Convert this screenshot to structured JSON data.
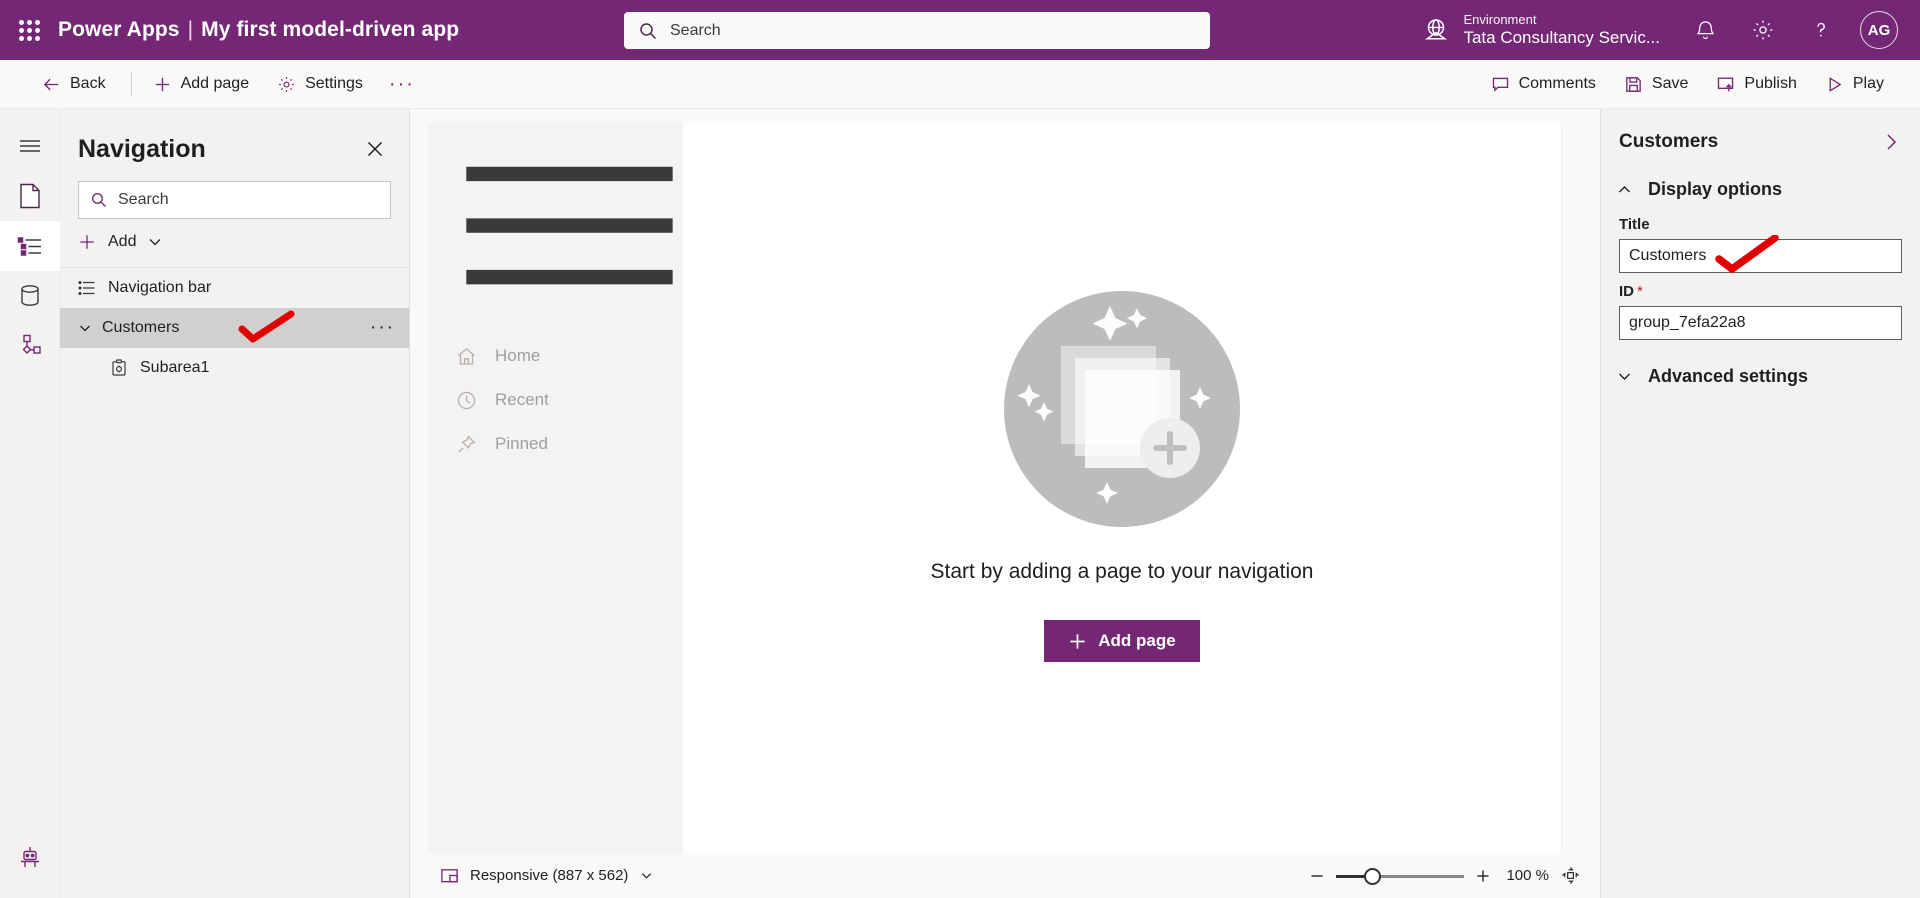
{
  "header": {
    "waffle_icon": "waffle-grid-icon",
    "brand": "Power Apps",
    "separator": "|",
    "app_name": "My first model-driven app",
    "search": {
      "placeholder": "Search",
      "value": "",
      "icon": "search-icon"
    },
    "environment": {
      "label": "Environment",
      "name": "Tata Consultancy Servic...",
      "icon": "globe-icon"
    },
    "notifications_icon": "bell-icon",
    "settings_icon": "gear-icon",
    "help_icon": "question-icon",
    "avatar_initials": "AG",
    "brand_color": "#742774"
  },
  "commandbar": {
    "back": "Back",
    "add_page": "Add page",
    "settings": "Settings",
    "overflow": "···",
    "comments": "Comments",
    "save": "Save",
    "publish": "Publish",
    "play": "Play"
  },
  "rail": {
    "items": [
      {
        "name": "pages-menu",
        "icon": "hamburger-icon",
        "selected": false
      },
      {
        "name": "pages",
        "icon": "page-icon",
        "selected": false
      },
      {
        "name": "navigation",
        "icon": "navigation-tree-icon",
        "selected": true
      },
      {
        "name": "data",
        "icon": "database-icon",
        "selected": false
      },
      {
        "name": "automation",
        "icon": "flow-nodes-icon",
        "selected": false
      }
    ],
    "bottom_icon": "copilot-robot-icon"
  },
  "navigation_panel": {
    "title": "Navigation",
    "close_icon": "close-icon",
    "search": {
      "placeholder": "Search",
      "value": "",
      "icon": "search-icon"
    },
    "add": {
      "label": "Add",
      "plus_icon": "plus-icon",
      "chevron_icon": "chevron-down-icon"
    },
    "tree": [
      {
        "label": "Navigation bar",
        "icon": "list-icon",
        "level": 0,
        "selected": false,
        "expandable": false
      },
      {
        "label": "Customers",
        "icon": "group-icon",
        "level": 0,
        "selected": true,
        "expandable": true,
        "more": "···"
      },
      {
        "label": "Subarea1",
        "icon": "subarea-icon",
        "level": 1,
        "selected": false,
        "expandable": false
      }
    ]
  },
  "preview": {
    "hamburger_icon": "hamburger-icon",
    "nav_items": [
      {
        "label": "Home",
        "icon": "home-icon"
      },
      {
        "label": "Recent",
        "icon": "clock-icon"
      },
      {
        "label": "Pinned",
        "icon": "pin-icon"
      }
    ],
    "empty_state": {
      "illustration": "stacked-pages-plus-illustration",
      "message": "Start by adding a page to your navigation",
      "button_label": "Add page",
      "button_icon": "plus-icon"
    }
  },
  "statusbar": {
    "responsive_label": "Responsive (887 x 562)",
    "responsive_icon": "device-frame-icon",
    "chevron_icon": "chevron-down-icon",
    "zoom_out_icon": "minus-icon",
    "zoom_in_icon": "plus-icon",
    "zoom_level": "100 %",
    "fit_icon": "fit-to-screen-icon"
  },
  "properties": {
    "title": "Customers",
    "expand_icon": "chevron-right-icon",
    "sections": [
      {
        "label": "Display options",
        "expanded": true,
        "icon": "chevron-up-icon"
      },
      {
        "label": "Advanced settings",
        "expanded": false,
        "icon": "chevron-down-icon"
      }
    ],
    "fields": [
      {
        "label": "Title",
        "required": false,
        "value": "Customers"
      },
      {
        "label": "ID",
        "required": true,
        "required_mark": "*",
        "value": "group_7efa22a8"
      }
    ]
  },
  "annotations": {
    "color": "#e00000",
    "marks": [
      {
        "name": "checkmark-tree-customers"
      },
      {
        "name": "checkmark-title-field"
      }
    ]
  }
}
